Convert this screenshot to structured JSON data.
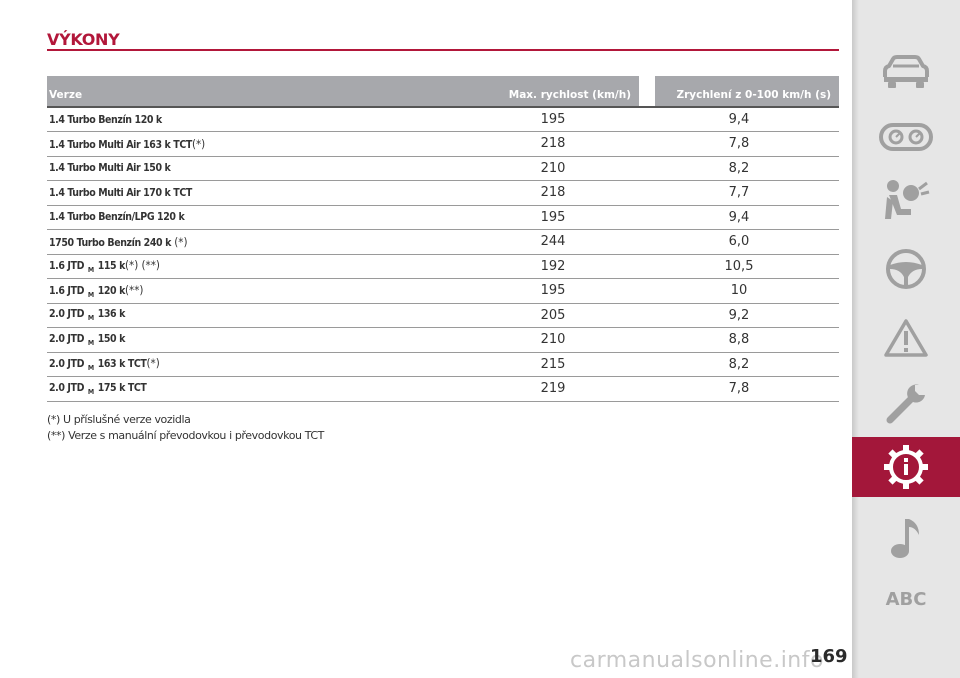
{
  "section": {
    "title": "VÝKONY"
  },
  "table": {
    "headers": {
      "version": "Verze",
      "speed": "Max. rychlost (km/h)",
      "accel": "Zrychlení z 0-100 km/h (s)"
    },
    "rows": [
      {
        "pre": "1.4 Turbo Benzín 120 k",
        "sub": "",
        "post": "",
        "note": "",
        "speed": "195",
        "accel": "9,4"
      },
      {
        "pre": "1.4 Turbo Multi Air 163 k TCT",
        "sub": "",
        "post": "",
        "note": "(*)",
        "speed": "218",
        "accel": "7,8"
      },
      {
        "pre": "1.4 Turbo Multi Air 150 k",
        "sub": "",
        "post": "",
        "note": "",
        "speed": "210",
        "accel": "8,2"
      },
      {
        "pre": "1.4 Turbo Multi Air 170 k TCT",
        "sub": "",
        "post": "",
        "note": "",
        "speed": "218",
        "accel": "7,7"
      },
      {
        "pre": "1.4 Turbo Benzín/LPG 120 k",
        "sub": "",
        "post": "",
        "note": "",
        "speed": "195",
        "accel": "9,4"
      },
      {
        "pre": "1750 Turbo Benzín 240 k",
        "sub": "",
        "post": "",
        "note": " (*)",
        "speed": "244",
        "accel": "6,0"
      },
      {
        "pre": "1.6 JTD",
        "sub": "M",
        "post": "115 k",
        "note": "(*) (**)",
        "speed": "192",
        "accel": "10,5"
      },
      {
        "pre": "1.6 JTD",
        "sub": "M",
        "post": "120 k",
        "note": "(**)",
        "speed": "195",
        "accel": "10"
      },
      {
        "pre": "2.0 JTD",
        "sub": "M",
        "post": "136 k",
        "note": "",
        "speed": "205",
        "accel": "9,2"
      },
      {
        "pre": "2.0 JTD",
        "sub": "M",
        "post": "150 k",
        "note": "",
        "speed": "210",
        "accel": "8,8"
      },
      {
        "pre": "2.0 JTD",
        "sub": "M",
        "post": "163 k TCT",
        "note": "(*)",
        "speed": "215",
        "accel": "8,2"
      },
      {
        "pre": "2.0 JTD",
        "sub": "M",
        "post": "175 k TCT",
        "note": "",
        "speed": "219",
        "accel": "7,8"
      }
    ]
  },
  "footnotes": [
    "(*) U příslušné verze vozidla",
    "(**) Verze s manuální převodovkou i převodovkou TCT"
  ],
  "sidebar": {
    "items": [
      {
        "icon": "car-icon"
      },
      {
        "icon": "dashboard-gauges-icon"
      },
      {
        "icon": "airbag-seat-icon"
      },
      {
        "icon": "steering-wheel-icon"
      },
      {
        "icon": "warning-triangle-icon"
      },
      {
        "icon": "wrench-icon"
      },
      {
        "icon": "technical-data-gear-icon",
        "active": true,
        "active_color": "#a3173a"
      },
      {
        "icon": "music-note-icon"
      },
      {
        "icon": "abc-index-icon",
        "label": "ABC"
      }
    ]
  },
  "page": {
    "number": "169"
  },
  "watermark": {
    "text": "carmanualsonline.info"
  },
  "colors": {
    "accent": "#b2173a",
    "header_gray": "#a7a8ac",
    "sidebar_bg": "#e6e6e6",
    "icon_gray": "#a0a0a0"
  }
}
